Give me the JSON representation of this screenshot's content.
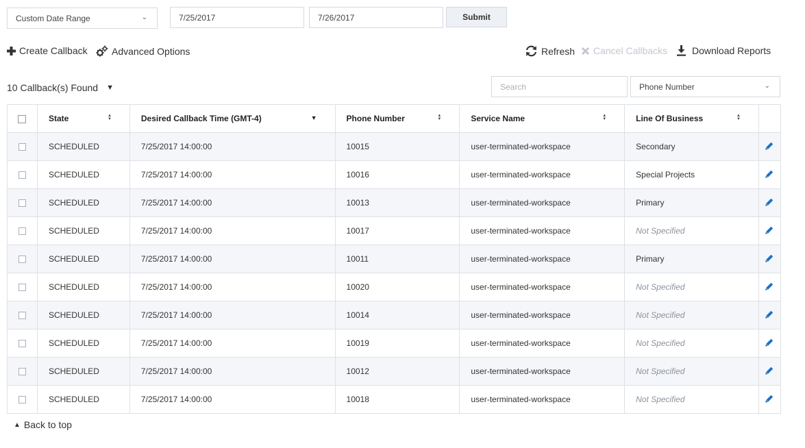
{
  "filters": {
    "range_select": "Custom Date Range",
    "start_date": "7/25/2017",
    "end_date": "7/26/2017",
    "submit_label": "Submit"
  },
  "actions": {
    "create": "Create Callback",
    "advanced": "Advanced Options",
    "refresh": "Refresh",
    "cancel": "Cancel Callbacks",
    "download": "Download Reports"
  },
  "results": {
    "found": "10 Callback(s) Found"
  },
  "search": {
    "placeholder": "Search",
    "field_select": "Phone Number"
  },
  "table": {
    "headers": {
      "state": "State",
      "time": "Desired Callback Time (GMT-4)",
      "phone": "Phone Number",
      "service": "Service Name",
      "lob": "Line Of Business"
    },
    "rows": [
      {
        "state": "SCHEDULED",
        "time": "7/25/2017 14:00:00",
        "phone": "10015",
        "service": "user-terminated-workspace",
        "lob": "Secondary"
      },
      {
        "state": "SCHEDULED",
        "time": "7/25/2017 14:00:00",
        "phone": "10016",
        "service": "user-terminated-workspace",
        "lob": "Special Projects"
      },
      {
        "state": "SCHEDULED",
        "time": "7/25/2017 14:00:00",
        "phone": "10013",
        "service": "user-terminated-workspace",
        "lob": "Primary"
      },
      {
        "state": "SCHEDULED",
        "time": "7/25/2017 14:00:00",
        "phone": "10017",
        "service": "user-terminated-workspace",
        "lob": "Not Specified"
      },
      {
        "state": "SCHEDULED",
        "time": "7/25/2017 14:00:00",
        "phone": "10011",
        "service": "user-terminated-workspace",
        "lob": "Primary"
      },
      {
        "state": "SCHEDULED",
        "time": "7/25/2017 14:00:00",
        "phone": "10020",
        "service": "user-terminated-workspace",
        "lob": "Not Specified"
      },
      {
        "state": "SCHEDULED",
        "time": "7/25/2017 14:00:00",
        "phone": "10014",
        "service": "user-terminated-workspace",
        "lob": "Not Specified"
      },
      {
        "state": "SCHEDULED",
        "time": "7/25/2017 14:00:00",
        "phone": "10019",
        "service": "user-terminated-workspace",
        "lob": "Not Specified"
      },
      {
        "state": "SCHEDULED",
        "time": "7/25/2017 14:00:00",
        "phone": "10012",
        "service": "user-terminated-workspace",
        "lob": "Not Specified"
      },
      {
        "state": "SCHEDULED",
        "time": "7/25/2017 14:00:00",
        "phone": "10018",
        "service": "user-terminated-workspace",
        "lob": "Not Specified"
      }
    ]
  },
  "footer": {
    "back_to_top": "Back to top"
  },
  "icons": {
    "create": "plus-icon",
    "advanced": "gears-icon",
    "refresh": "refresh-icon",
    "cancel": "x-icon",
    "download": "download-icon",
    "edit": "pencil-icon",
    "sort": "sort-icon",
    "caret": "caret-down-icon",
    "chevron": "chevron-down-icon",
    "back": "triangle-up-icon"
  },
  "colors": {
    "accent": "#1f6fc5",
    "disabled": "#c3c8cf",
    "row_alt": "#f4f6f9",
    "muted": "#8d939a"
  }
}
